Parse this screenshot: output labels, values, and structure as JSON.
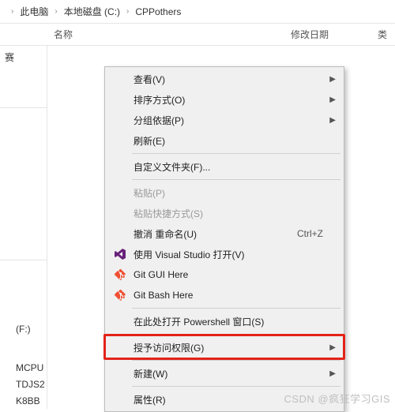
{
  "breadcrumb": {
    "this_pc": "此电脑",
    "drive": "本地磁盘 (C:)",
    "folder": "CPPothers"
  },
  "columns": {
    "name": "名称",
    "date_modified": "修改日期",
    "type": "类"
  },
  "sidebar": {
    "items": [
      {
        "label": "赛"
      },
      {
        "label": ""
      },
      {
        "label": ""
      },
      {
        "label": "(F:)"
      },
      {
        "label": ""
      },
      {
        "label": "MCPU"
      },
      {
        "label": "TDJS2"
      },
      {
        "label": "K8BB"
      }
    ]
  },
  "context_menu": {
    "items": [
      {
        "label": "查看(V)",
        "submenu": true
      },
      {
        "label": "排序方式(O)",
        "submenu": true
      },
      {
        "label": "分组依据(P)",
        "submenu": true
      },
      {
        "label": "刷新(E)"
      },
      {
        "sep": true
      },
      {
        "label": "自定义文件夹(F)..."
      },
      {
        "sep": true
      },
      {
        "label": "粘贴(P)",
        "disabled": true
      },
      {
        "label": "粘贴快捷方式(S)",
        "disabled": true
      },
      {
        "label": "撤消 重命名(U)",
        "shortcut": "Ctrl+Z"
      },
      {
        "label": "使用 Visual Studio 打开(V)",
        "icon": "vs"
      },
      {
        "label": "Git GUI Here",
        "icon": "git"
      },
      {
        "label": "Git Bash Here",
        "icon": "git"
      },
      {
        "sep": true
      },
      {
        "label": "在此处打开 Powershell 窗口(S)",
        "highlighted": true
      },
      {
        "sep": true
      },
      {
        "label": "授予访问权限(G)",
        "submenu": true
      },
      {
        "sep": true
      },
      {
        "label": "新建(W)",
        "submenu": true
      },
      {
        "sep": true
      },
      {
        "label": "属性(R)"
      }
    ]
  },
  "watermark": "CSDN @疯狂学习GIS"
}
